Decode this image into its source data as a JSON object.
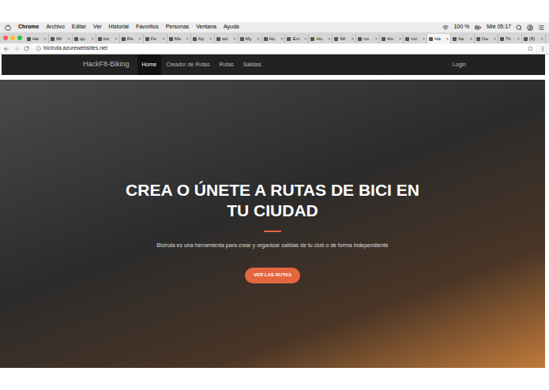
{
  "menu_bar": {
    "app": "Chrome",
    "items": [
      "Archivo",
      "Editar",
      "Ver",
      "Historial",
      "Favoritos",
      "Personas",
      "Ventana",
      "Ayuda"
    ],
    "battery": "100 %",
    "clock": "Mié 05:17"
  },
  "tab_close": "×",
  "tabs": [
    {
      "label": "Ha",
      "selected": false
    },
    {
      "label": "Wr",
      "selected": false
    },
    {
      "label": "qu",
      "selected": false
    },
    {
      "label": "bic",
      "selected": false
    },
    {
      "label": "Re",
      "selected": false
    },
    {
      "label": "Fe",
      "selected": false
    },
    {
      "label": "Me",
      "selected": false
    },
    {
      "label": "Ap",
      "selected": false
    },
    {
      "label": "ssl",
      "selected": false
    },
    {
      "label": "My",
      "selected": false
    },
    {
      "label": "Ho",
      "selected": false
    },
    {
      "label": "Em",
      "selected": false
    },
    {
      "label": "Ho",
      "selected": false
    },
    {
      "label": "Wi",
      "selected": false
    },
    {
      "label": "no",
      "selected": false
    },
    {
      "label": "Ho",
      "selected": false
    },
    {
      "label": "mc",
      "selected": false
    },
    {
      "label": "Ha",
      "selected": true
    },
    {
      "label": "ha",
      "selected": false
    },
    {
      "label": "Ge",
      "selected": false
    },
    {
      "label": "Tir",
      "selected": false
    },
    {
      "label": "(8)",
      "selected": false
    }
  ],
  "address_bar": {
    "url": "biciruta.azurewebsites.net"
  },
  "site_nav": {
    "brand": "HackF8-Biking",
    "items": [
      {
        "label": "Home",
        "selected": true
      },
      {
        "label": "Creador de Rutas",
        "selected": false
      },
      {
        "label": "Rutas",
        "selected": false
      },
      {
        "label": "Salidas",
        "selected": false
      }
    ],
    "login": "Login"
  },
  "hero": {
    "title": "CREA O ÚNETE A RUTAS DE BICI EN TU CIUDAD",
    "subtitle": "Biciruta es una herramienta para crear y organizar salidas de tu club o de forma independiente",
    "button": "VER LAS RUTAS"
  }
}
